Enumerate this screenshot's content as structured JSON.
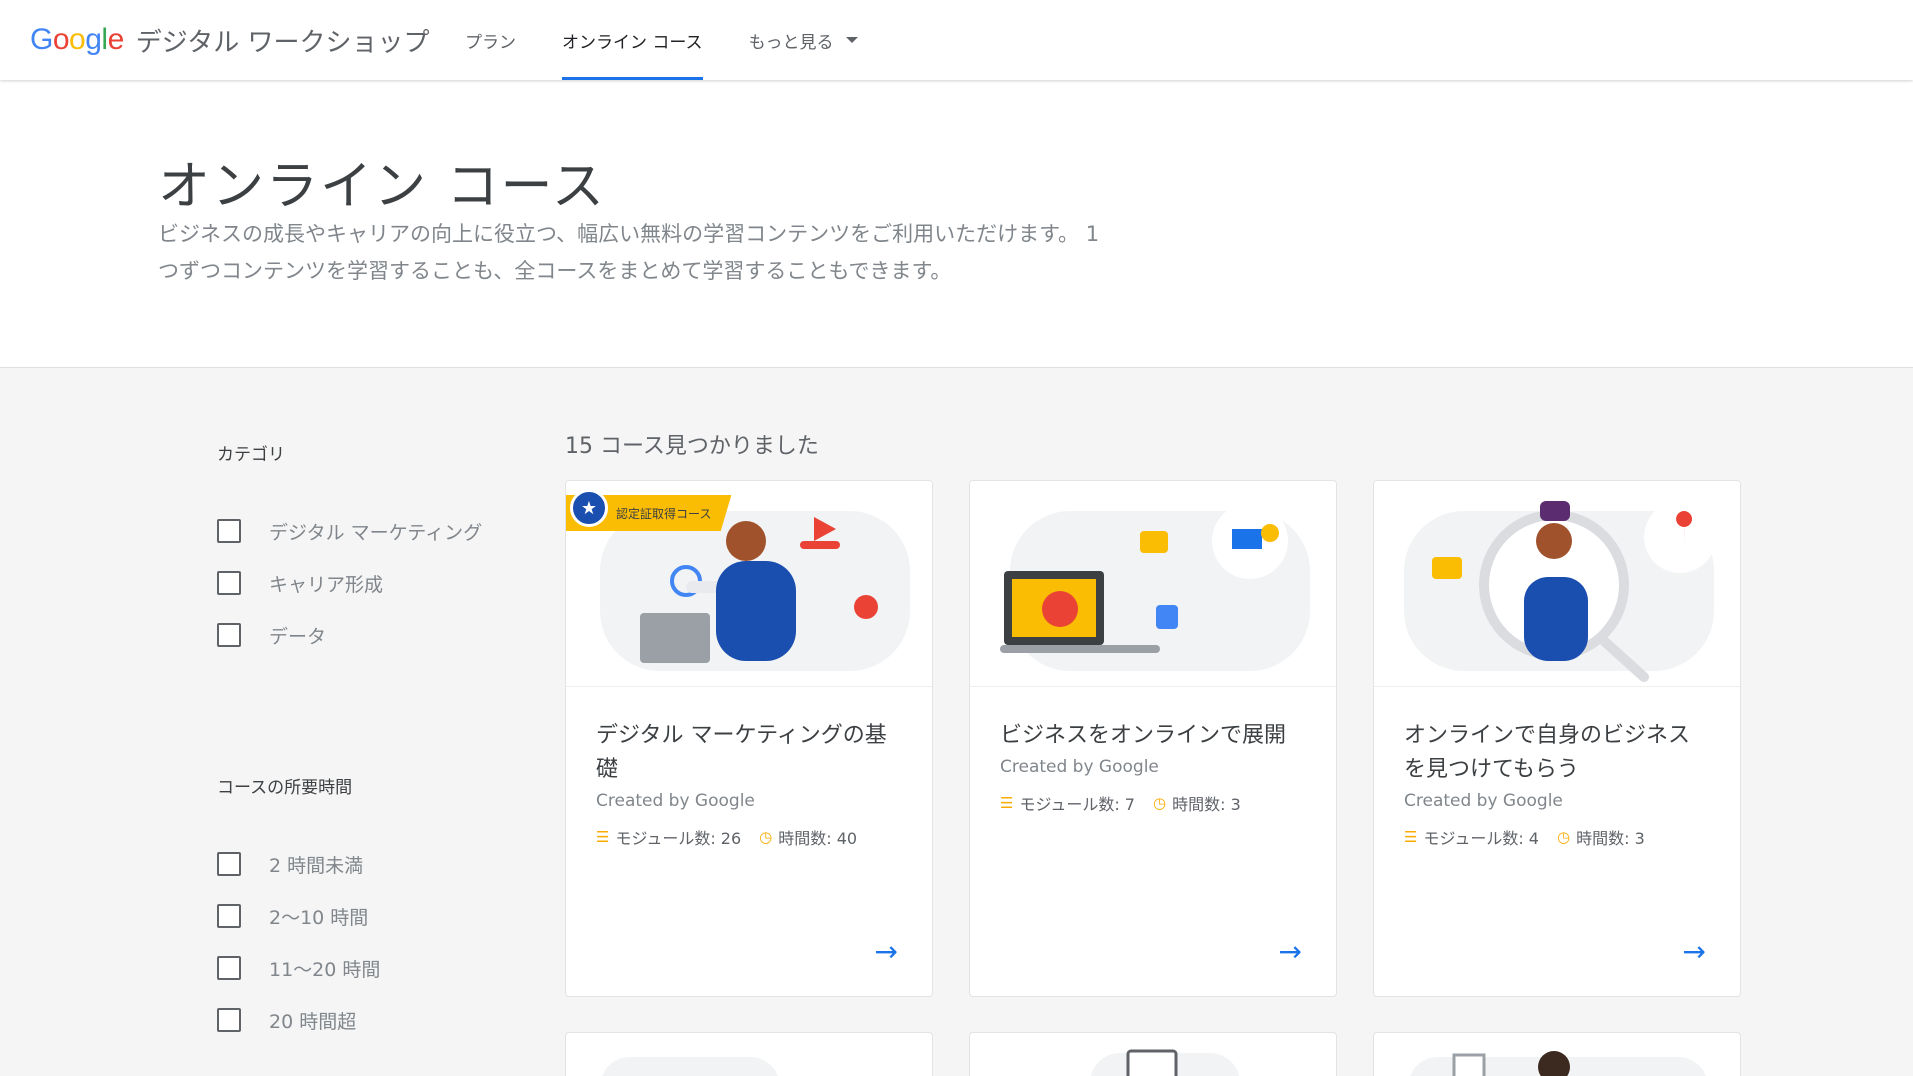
{
  "header": {
    "logo_text": "Google",
    "site_title": "デジタル ワークショップ",
    "nav": [
      {
        "label": "プラン"
      },
      {
        "label": "オンライン コース"
      },
      {
        "label": "もっと見る"
      }
    ]
  },
  "hero": {
    "title": "オンライン コース",
    "description": "ビジネスの成長やキャリアの向上に役立つ、幅広い無料の学習コンテンツをご利用いただけます。 1 つずつコンテンツを学習することも、全コースをまとめて学習することもできます。"
  },
  "filters": {
    "category": {
      "title": "カテゴリ",
      "options": [
        "デジタル マーケティング",
        "キャリア形成",
        "データ"
      ]
    },
    "duration": {
      "title": "コースの所要時間",
      "options": [
        "2 時間未満",
        "2〜10 時間",
        "11〜20 時間",
        "20 時間超"
      ]
    }
  },
  "results": {
    "count_text": "15 コース見つかりました",
    "cards": [
      {
        "title": "デジタル マーケティングの基礎",
        "creator": "Created by Google",
        "modules": "モジュール数: 26",
        "hours": "時間数: 40",
        "badge": "認定証取得コース"
      },
      {
        "title": "ビジネスをオンラインで展開",
        "creator": "Created by Google",
        "modules": "モジュール数: 7",
        "hours": "時間数: 3"
      },
      {
        "title": "オンラインで自身のビジネスを見つけてもらう",
        "creator": "Created by Google",
        "modules": "モジュール数: 4",
        "hours": "時間数: 3"
      }
    ]
  },
  "colors": {
    "accent": "#1a73e8",
    "badge": "#fbbc04",
    "meta_icon": "#f9ab00"
  },
  "icons": {
    "modules": "list-icon",
    "hours": "clock-icon",
    "card_link": "arrow-right-icon",
    "dropdown": "caret-down-icon",
    "badge": "medal-icon"
  }
}
